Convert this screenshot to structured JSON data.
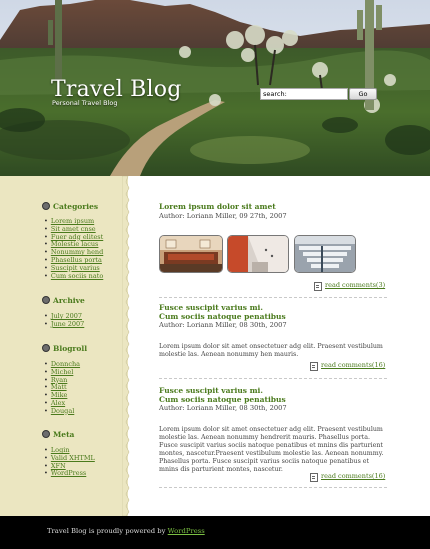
{
  "header": {
    "title": "Travel Blog",
    "tagline": "Personal Travel Blog",
    "search": {
      "value": "search:",
      "button_label": "Go"
    }
  },
  "sidebar": {
    "categories": {
      "title": "Categories",
      "items": [
        "Lorem ipsum",
        "Sit amet cnse",
        "Fuer adg elitest",
        "Molestie lacus",
        "Nonummy hend",
        "Phasellus porta",
        "Suscipit varius",
        "Cum sociis nato"
      ]
    },
    "archive": {
      "title": "Archive",
      "items": [
        "July 2007",
        "June 2007"
      ]
    },
    "blogroll": {
      "title": "Blogroll",
      "items": [
        "Donncha",
        "Michel",
        "Ryan",
        "Matt",
        "Mike",
        "Alex",
        "Dougal"
      ]
    },
    "meta": {
      "title": "Meta",
      "items": [
        "Login",
        "Valid XHTML",
        "XFN",
        "WordPress"
      ]
    }
  },
  "posts": [
    {
      "title_line1": "Lorem ipsum dolor sit amet",
      "title_line2": "",
      "meta": "Author: Loriann Miller, 09 27th, 2007",
      "body": "",
      "comments": "read comments(3)"
    },
    {
      "title_line1": "Fusce suscipit varius mi.",
      "title_line2": "Cum sociis natoque penatibus",
      "meta": "Author: Loriann Miller, 08 30th, 2007",
      "body": "Lorem ipsum dolor sit amet onsectetuer adg elit. Praesent vestibulum molestie las. Aenean nonummy hen mauris.",
      "comments": "read comments(16)"
    },
    {
      "title_line1": "Fusce suscipit varius mi.",
      "title_line2": "Cum sociis natoque penatibus",
      "meta": "Author: Loriann Miller, 08 30th, 2007",
      "body": "Lorem ipsum dolor sit amet onsectetuer adg elit. Praesent vestibulum molestie las. Aenean nonummy hendrerit mauris. Phasellus porta. Fusce suscipit varius sociis natoque penatibus et mnins dis parturient montes, nascetur.Praesent vestibulum molestie las. Aenean nonummy. Phasellus porta. Fusce suscipit varius sociis natoque penatibus et mnins dis parturient montes, nascetur.",
      "comments": "read comments(16)"
    }
  ],
  "footer": {
    "text": "Travel Blog is proudly powered by",
    "link": "WordPress"
  },
  "colors": {
    "accent": "#4a7a1c",
    "sidebar_bg": "#ebe6c1",
    "footer_bg": "#000000"
  }
}
